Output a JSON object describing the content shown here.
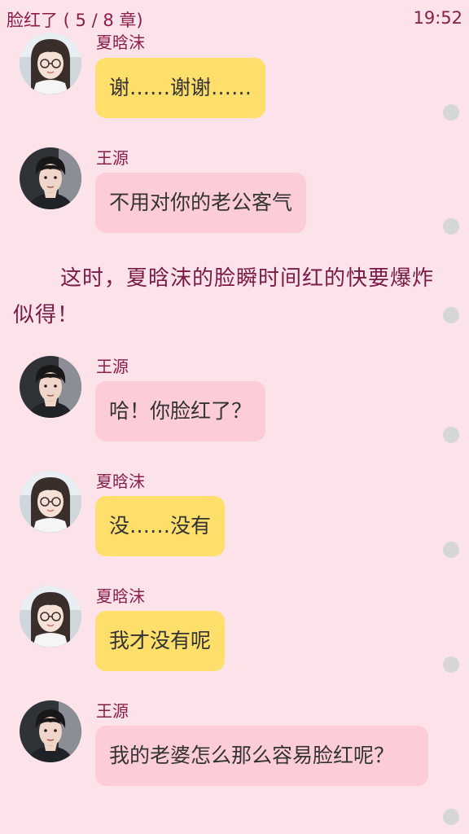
{
  "header": {
    "chapter_title": "脸红了 ( 5 / 8 章)",
    "time": "19:52"
  },
  "colors": {
    "background": "#fbe3e9",
    "bubble_yellow": "#fedf6c",
    "bubble_pink": "#fdcdd7",
    "accent_text": "#8a1d4a",
    "dot": "#d6d6d6"
  },
  "messages": [
    {
      "sender": "夏晗沫",
      "text": "谢……谢谢……",
      "bubble": "yellow",
      "avatar": "girl-avatar"
    },
    {
      "sender": "王源",
      "text": "不用对你的老公客气",
      "bubble": "pink",
      "avatar": "boy-avatar"
    },
    {
      "sender": "王源",
      "text": "哈！你脸红了？",
      "bubble": "pink",
      "avatar": "boy-avatar"
    },
    {
      "sender": "夏晗沫",
      "text": "没……没有",
      "bubble": "yellow",
      "avatar": "girl-avatar"
    },
    {
      "sender": "夏晗沫",
      "text": "我才没有呢",
      "bubble": "yellow",
      "avatar": "girl-avatar"
    },
    {
      "sender": "王源",
      "text": "我的老婆怎么那么容易脸红呢？",
      "bubble": "pink",
      "avatar": "boy-avatar"
    }
  ],
  "narration": "这时，夏晗沫的脸瞬时间红的快要爆炸似得！"
}
